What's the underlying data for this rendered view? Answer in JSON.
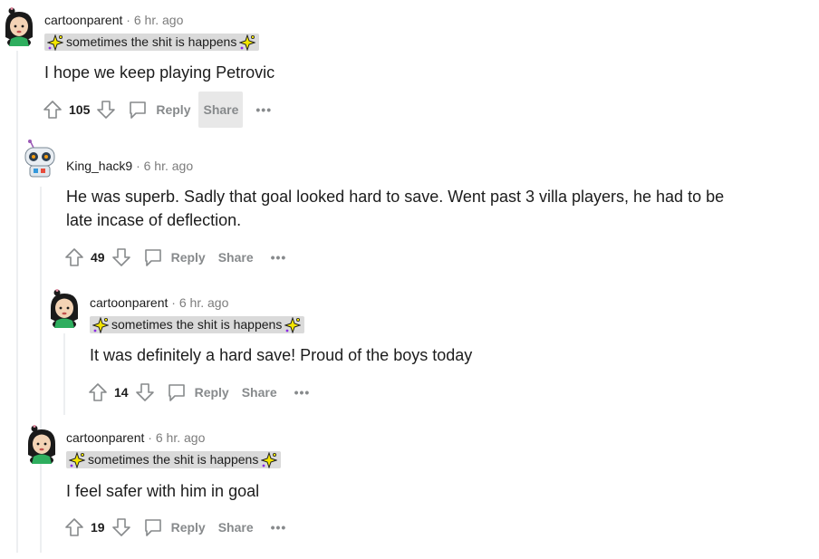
{
  "comments": [
    {
      "author": "cartoonparent",
      "time": "6 hr. ago",
      "flair": "sometimes the shit is happens",
      "body": "I hope we keep playing Petrovic",
      "score": "105",
      "reply": "Reply",
      "share": "Share",
      "more": "•••"
    },
    {
      "author": "King_hack9",
      "time": "6 hr. ago",
      "flair": "",
      "body": "He was superb. Sadly that goal looked hard to save. Went past 3 villa players, he had to be late incase of deflection.",
      "score": "49",
      "reply": "Reply",
      "share": "Share",
      "more": "•••"
    },
    {
      "author": "cartoonparent",
      "time": "6 hr. ago",
      "flair": "sometimes the shit is happens",
      "body": "It was definitely a hard save! Proud of the boys today",
      "score": "14",
      "reply": "Reply",
      "share": "Share",
      "more": "•••"
    },
    {
      "author": "cartoonparent",
      "time": "6 hr. ago",
      "flair": "sometimes the shit is happens",
      "body": "I feel safer with him in goal",
      "score": "19",
      "reply": "Reply",
      "share": "Share",
      "more": "•••"
    }
  ],
  "separator": "·",
  "colors": {
    "flair_bg": "#dadada",
    "meta_gray": "#7c7c7c",
    "action_gray": "#878a8c",
    "thread_line": "#edeff1",
    "share_hover_bg": "#e8e8e8"
  },
  "icons": {
    "upvote": "upvote-arrow-icon",
    "downvote": "downvote-arrow-icon",
    "reply": "speech-bubble-icon",
    "flair_emoji": "sparkle-icon",
    "avatar_a": "cartoon-girl-avatar",
    "avatar_b": "robot-avatar"
  }
}
